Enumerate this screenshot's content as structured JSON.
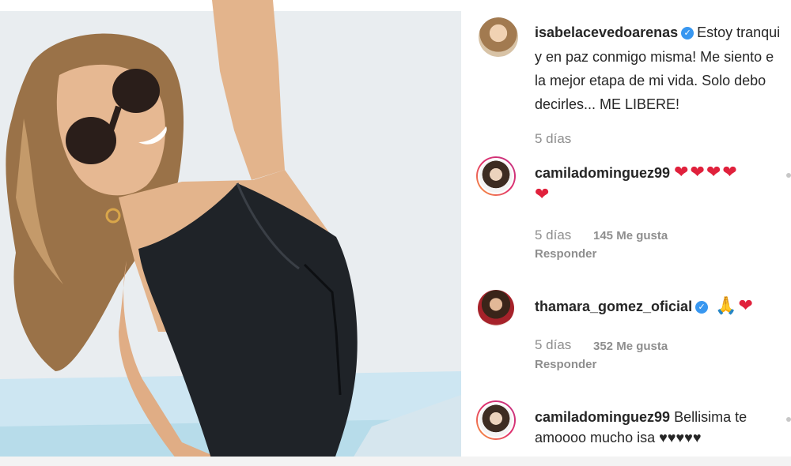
{
  "post": {
    "author": {
      "username": "isabelacevedoarenas",
      "verified": true,
      "caption_lines": [
        "Estoy tranqui",
        "y en paz conmigo misma! Me siento e",
        "la mejor etapa de mi vida. Solo debo",
        "decirles... ME LIBERE!"
      ],
      "time": "5 días"
    }
  },
  "comments": [
    {
      "username": "camiladominguez99",
      "verified": false,
      "text_line1": "❤❤❤❤",
      "text_line2": "❤",
      "time": "5 días",
      "likes": "145 Me gusta",
      "reply": "Responder"
    },
    {
      "username": "thamara_gomez_oficial",
      "verified": true,
      "text_line1": "🙏❤",
      "time": "5 días",
      "likes": "352 Me gusta",
      "reply": "Responder"
    },
    {
      "username": "camiladominguez99",
      "verified": false,
      "text_line1": "Bellisima te",
      "text_line2": "amoooo mucho isa ♥♥♥♥♥"
    }
  ],
  "icons": {
    "verified": "verified-badge-icon",
    "heart": "heart-emoji",
    "pray": "praying-hands-emoji"
  },
  "colors": {
    "verified_blue": "#3897f0",
    "heart_red": "#e0213c",
    "meta_gray": "#8e8e8e",
    "text_dark": "#262626"
  }
}
